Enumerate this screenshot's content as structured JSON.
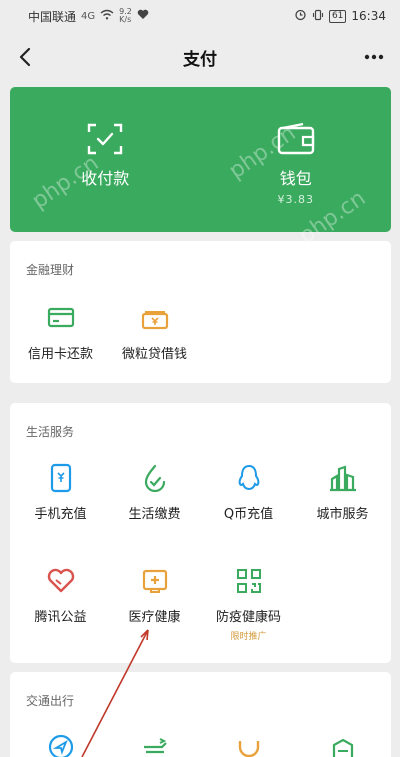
{
  "status_bar": {
    "carrier": "中国联通",
    "signal": "4G",
    "speed": "9.2\nK/s",
    "battery": "61",
    "time": "16:34"
  },
  "nav": {
    "title": "支付"
  },
  "top_card": {
    "collect": {
      "label": "收付款"
    },
    "wallet": {
      "label": "钱包",
      "amount": "¥3.83"
    }
  },
  "finance": {
    "title": "金融理财",
    "items": [
      {
        "label": "信用卡还款"
      },
      {
        "label": "微粒贷借钱"
      }
    ]
  },
  "life": {
    "title": "生活服务",
    "items": [
      {
        "label": "手机充值"
      },
      {
        "label": "生活缴费"
      },
      {
        "label": "Q币充值"
      },
      {
        "label": "城市服务"
      },
      {
        "label": "腾讯公益"
      },
      {
        "label": "医疗健康"
      },
      {
        "label": "防疫健康码",
        "tag": "限时推广"
      }
    ]
  },
  "transport": {
    "title": "交通出行"
  },
  "watermark": "php.cn",
  "colors": {
    "accent_green": "#3aaa5e",
    "icon_blue": "#1e9be8",
    "icon_orange": "#e9a23b",
    "icon_red": "#d9534f",
    "tag_orange": "#d39a3a"
  }
}
